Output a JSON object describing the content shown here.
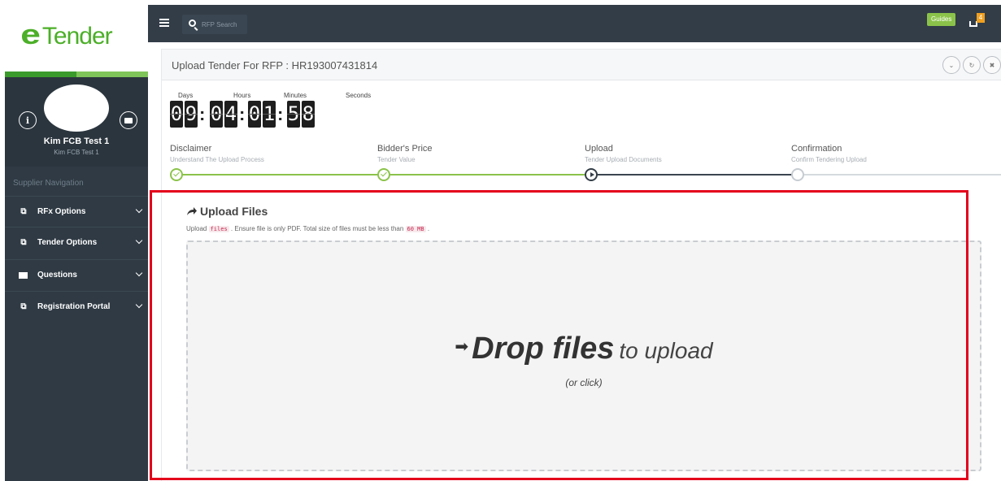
{
  "brand": {
    "logo_text": "Tender",
    "logo_mark": "e"
  },
  "profile": {
    "name": "Kim FCB Test 1",
    "subtitle": "Kim FCB Test 1"
  },
  "sidebar": {
    "heading": "Supplier Navigation",
    "items": [
      {
        "label": "RFx Options",
        "icon": "copy-icon"
      },
      {
        "label": "Tender Options",
        "icon": "copy-icon"
      },
      {
        "label": "Questions",
        "icon": "envelope-icon"
      },
      {
        "label": "Registration Portal",
        "icon": "copy-icon"
      }
    ]
  },
  "topbar": {
    "search_placeholder": "RFP Search",
    "guides_label": "Guides",
    "cart_count": "4"
  },
  "panel": {
    "title": "Upload Tender For RFP : HR193007431814"
  },
  "countdown": {
    "labels": {
      "days": "Days",
      "hours": "Hours",
      "minutes": "Minutes",
      "seconds": "Seconds"
    },
    "days": [
      "0",
      "9"
    ],
    "hours": [
      "0",
      "4"
    ],
    "minutes": [
      "0",
      "1"
    ],
    "seconds": [
      "5",
      "8"
    ]
  },
  "steps": [
    {
      "title": "Disclaimer",
      "subtitle": "Understand The Upload Process",
      "state": "done"
    },
    {
      "title": "Bidder's Price",
      "subtitle": "Tender Value",
      "state": "done"
    },
    {
      "title": "Upload",
      "subtitle": "Tender Upload Documents",
      "state": "current"
    },
    {
      "title": "Confirmation",
      "subtitle": "Confirm Tendering Upload",
      "state": "pending"
    }
  ],
  "upload": {
    "title": "Upload Files",
    "help_prefix": "Upload",
    "help_code1": "files",
    "help_middle": ". Ensure file is only PDF. Total size of files must be less than",
    "help_code2": "60 MB",
    "help_suffix": ".",
    "drop_strong": "Drop files",
    "drop_rest": "to upload",
    "drop_sub": "(or click)"
  },
  "colors": {
    "accent_green": "#8bc34a",
    "sidebar_bg": "#2f3a44",
    "highlight_red": "#e3001b"
  }
}
